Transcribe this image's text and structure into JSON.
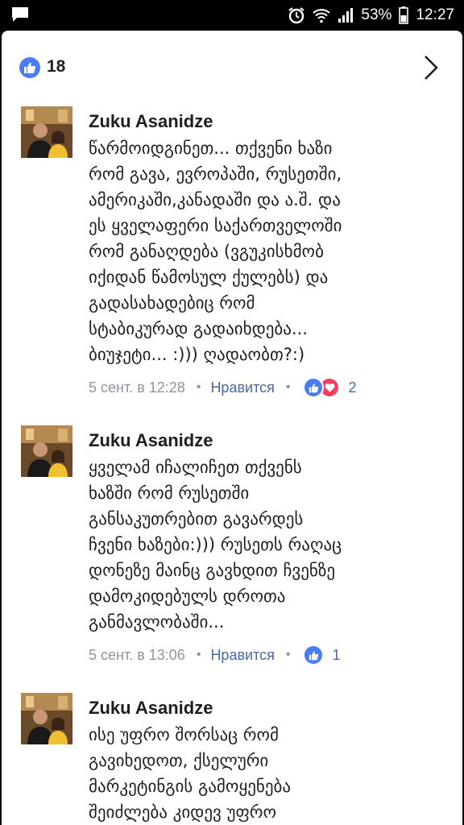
{
  "status_bar": {
    "battery": "53%",
    "time": "12:27",
    "icons": [
      "message-notification-icon",
      "alarm-icon",
      "wifi-icon",
      "signal-icon",
      "battery-icon"
    ]
  },
  "reactions": {
    "total": "18",
    "icon": "like-icon"
  },
  "comments": [
    {
      "author": "Zuku Asanidze",
      "lines": [
        "წარმოიდგინეთ... თქვენი ხაზი",
        "რომ გავა, ევროპაში, რუსეთში,",
        "ამერიკაში,კანადაში და ა.შ. და",
        "ეს ყველაფერი საქართველოში",
        "რომ განაღდება (ვგუკისხმობ",
        "იქიდან წამოსულ ქულებს) და",
        "გადასახადებიც რომ",
        "სტაბიკურად გადაიხდება...",
        "ბიუჯეტი... :))) ღადაობთ?:)"
      ],
      "timestamp": "5 сент. в 12:28",
      "like_label": "Нравится",
      "reaction_count": "2",
      "reaction_types": [
        "like",
        "love"
      ]
    },
    {
      "author": "Zuku Asanidze",
      "lines": [
        "ყველამ იჩალიჩეთ თქვენს",
        "ხაზში რომ რუსეთში",
        "განსაკუთრებით გავარდეს",
        "ჩვენი ხაზები:))) რუსეთს რაღაც",
        "დონეზე მაინც გავხდით ჩვენზე",
        "დამოკიდებულს დროთა",
        "განმავლობაში..."
      ],
      "timestamp": "5 сент. в 13:06",
      "like_label": "Нравится",
      "reaction_count": "1",
      "reaction_types": [
        "like"
      ]
    },
    {
      "author": "Zuku Asanidze",
      "lines": [
        "ისე უფრო შორსაც რომ",
        "გავიხედოთ, ქსელური",
        "მარკეტინგის გამოყენება",
        "შეიძლება კიდევ უფრო"
      ]
    }
  ],
  "colors": {
    "like_blue": "#4a7cf6",
    "love_red": "#f2405c",
    "link": "#4b67a1",
    "meta_gray": "#90949c"
  }
}
